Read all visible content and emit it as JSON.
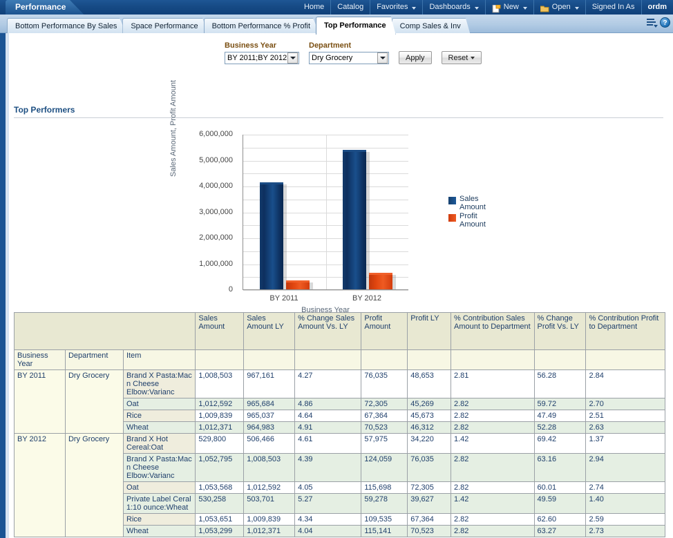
{
  "header": {
    "brand": "Performance",
    "nav": [
      {
        "label": "Home",
        "caret": false,
        "icon": null
      },
      {
        "label": "Catalog",
        "caret": false,
        "icon": null
      },
      {
        "label": "Favorites",
        "caret": true,
        "icon": null
      },
      {
        "label": "Dashboards",
        "caret": true,
        "icon": null
      },
      {
        "label": "New",
        "caret": true,
        "icon": "new-page-icon"
      },
      {
        "label": "Open",
        "caret": true,
        "icon": "folder-open-icon"
      },
      {
        "label": "Signed In As",
        "caret": false,
        "icon": null
      },
      {
        "label": "ordm",
        "caret": false,
        "icon": null
      }
    ]
  },
  "tabs": [
    {
      "label": "Bottom Performance By Sales",
      "active": false
    },
    {
      "label": "Space Performance",
      "active": false
    },
    {
      "label": "Bottom Performance % Profit",
      "active": false
    },
    {
      "label": "Top Performance",
      "active": true
    },
    {
      "label": "Comp Sales & Inv",
      "active": false
    }
  ],
  "tabstrip_icons": {
    "list": "page-options-icon",
    "help": "help-icon",
    "help_glyph": "?"
  },
  "prompts": {
    "business_year": {
      "label": "Business Year",
      "value": "BY 2011;BY 2012"
    },
    "department": {
      "label": "Department",
      "value": "Dry Grocery"
    },
    "apply_label": "Apply",
    "reset_label": "Reset"
  },
  "section": {
    "title": "Top Performers"
  },
  "chart_data": {
    "type": "bar",
    "title": "",
    "categories": [
      "BY 2011",
      "BY 2012"
    ],
    "series": [
      {
        "name": "Sales Amount",
        "values": [
          4050000,
          5300000
        ],
        "color": "#154a85"
      },
      {
        "name": "Profit Amount",
        "values": [
          280000,
          560000
        ],
        "color": "#e2480f"
      }
    ],
    "xlabel": "Business Year",
    "ylabel": "Sales Amount, Profit Amount",
    "ylim": [
      0,
      6000000
    ],
    "yticks": [
      "0",
      "1,000,000",
      "2,000,000",
      "3,000,000",
      "4,000,000",
      "5,000,000",
      "6,000,000"
    ],
    "ytick_values": [
      0,
      1000000,
      2000000,
      3000000,
      4000000,
      5000000,
      6000000
    ],
    "grid": true,
    "legend_position": "right"
  },
  "table": {
    "measure_headers": [
      "Sales Amount",
      "Sales Amount LY",
      "% Change Sales Amount Vs. LY",
      "Profit Amount",
      "Profit LY",
      "% Contribution Sales Amount to Department",
      "% Change Profit Vs. LY",
      "% Contribution Profit to Department"
    ],
    "dim_headers": [
      "Business Year",
      "Department",
      "Item"
    ],
    "rows": [
      {
        "year": "BY 2011",
        "dept": "Dry Grocery",
        "item": "Brand X Pasta:Mac n Cheese Elbow:Varianc",
        "values": [
          "1,008,503",
          "967,161",
          "4.27",
          "76,035",
          "48,653",
          "2.81",
          "56.28",
          "2.84"
        ],
        "first_of_group": true,
        "shade": "A"
      },
      {
        "year": "",
        "dept": "",
        "item": "Oat",
        "values": [
          "1,012,592",
          "965,684",
          "4.86",
          "72,305",
          "45,269",
          "2.82",
          "59.72",
          "2.70"
        ],
        "first_of_group": false,
        "shade": "B"
      },
      {
        "year": "",
        "dept": "",
        "item": "Rice",
        "values": [
          "1,009,839",
          "965,037",
          "4.64",
          "67,364",
          "45,673",
          "2.82",
          "47.49",
          "2.51"
        ],
        "first_of_group": false,
        "shade": "A"
      },
      {
        "year": "",
        "dept": "",
        "item": "Wheat",
        "values": [
          "1,012,371",
          "964,983",
          "4.91",
          "70,523",
          "46,312",
          "2.82",
          "52.28",
          "2.63"
        ],
        "first_of_group": false,
        "shade": "B"
      },
      {
        "year": "BY 2012",
        "dept": "Dry Grocery",
        "item": "Brand X Hot Cereal:Oat",
        "values": [
          "529,800",
          "506,466",
          "4.61",
          "57,975",
          "34,220",
          "1.42",
          "69.42",
          "1.37"
        ],
        "first_of_group": true,
        "shade": "A"
      },
      {
        "year": "",
        "dept": "",
        "item": "Brand X Pasta:Mac n Cheese Elbow:Varianc",
        "values": [
          "1,052,795",
          "1,008,503",
          "4.39",
          "124,059",
          "76,035",
          "2.82",
          "63.16",
          "2.94"
        ],
        "first_of_group": false,
        "shade": "B"
      },
      {
        "year": "",
        "dept": "",
        "item": "Oat",
        "values": [
          "1,053,568",
          "1,012,592",
          "4.05",
          "115,698",
          "72,305",
          "2.82",
          "60.01",
          "2.74"
        ],
        "first_of_group": false,
        "shade": "A"
      },
      {
        "year": "",
        "dept": "",
        "item": "Private Label Ceral 1:10 ounce:Wheat",
        "values": [
          "530,258",
          "503,701",
          "5.27",
          "59,278",
          "39,627",
          "1.42",
          "49.59",
          "1.40"
        ],
        "first_of_group": false,
        "shade": "B"
      },
      {
        "year": "",
        "dept": "",
        "item": "Rice",
        "values": [
          "1,053,651",
          "1,009,839",
          "4.34",
          "109,535",
          "67,364",
          "2.82",
          "62.60",
          "2.59"
        ],
        "first_of_group": false,
        "shade": "A"
      },
      {
        "year": "",
        "dept": "",
        "item": "Wheat",
        "values": [
          "1,053,299",
          "1,012,371",
          "4.04",
          "115,141",
          "70,523",
          "2.82",
          "63.27",
          "2.73"
        ],
        "first_of_group": false,
        "shade": "B"
      }
    ]
  },
  "colors": {
    "brand_blue": "#164a85",
    "sales_bar": "#154a85",
    "profit_bar": "#e2480f",
    "header_beige": "#e8e8d2",
    "row_green": "#e5efe3"
  }
}
